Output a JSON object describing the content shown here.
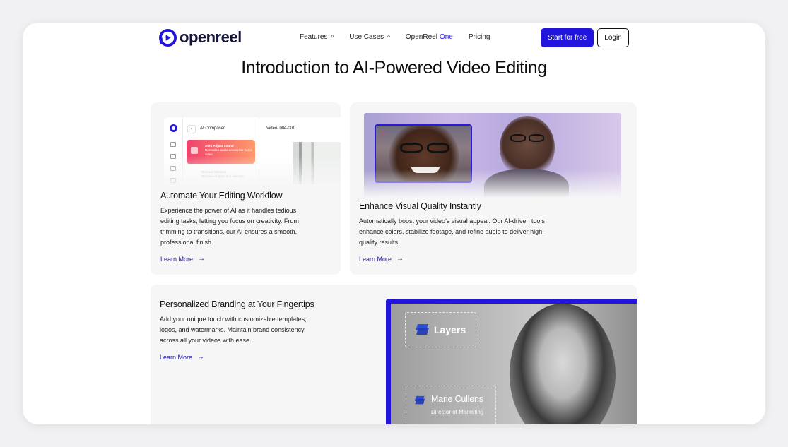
{
  "brand": {
    "name": "openreel",
    "accent": "#2114dc"
  },
  "nav": {
    "links": [
      {
        "label": "Features",
        "has_chevron": true
      },
      {
        "label": "Use Cases",
        "has_chevron": true
      },
      {
        "label": "OpenReel",
        "suffix": "One"
      },
      {
        "label": "Pricing"
      }
    ],
    "start_label": "Start for free",
    "login_label": "Login"
  },
  "headline": "Introduction to AI-Powered Video Editing",
  "cards": [
    {
      "title": "Automate Your Editing Workflow",
      "body": "Experience the power of AI as it handles tedious editing tasks, letting you focus on creativity. From trimming to transitions, our AI ensures a smooth, professional finish.",
      "link": "Learn More",
      "mock": {
        "panel_title": "AI Composer",
        "video_title": "Video-Title-001",
        "pill_title": "Auto Adjust Sound",
        "pill_text": "Normalize audio across the entire video",
        "ghost_title": "Remove Silences",
        "ghost_text": "Remove all gaps and silences"
      }
    },
    {
      "title": "Enhance Visual Quality Instantly",
      "body": "Automatically boost your video's visual appeal. Our AI-driven tools enhance colors, stabilize footage, and refine audio to deliver high-quality results.",
      "link": "Learn More"
    },
    {
      "title": "Personalized Branding at Your Fingertips",
      "body": "Add your unique touch with customizable templates, logos, and watermarks. Maintain brand consistency across all your videos with ease.",
      "link": "Learn More",
      "overlay": {
        "logo_text": "Layers",
        "person_name": "Marie Cullens",
        "person_role": "Director of Marketing"
      }
    }
  ]
}
